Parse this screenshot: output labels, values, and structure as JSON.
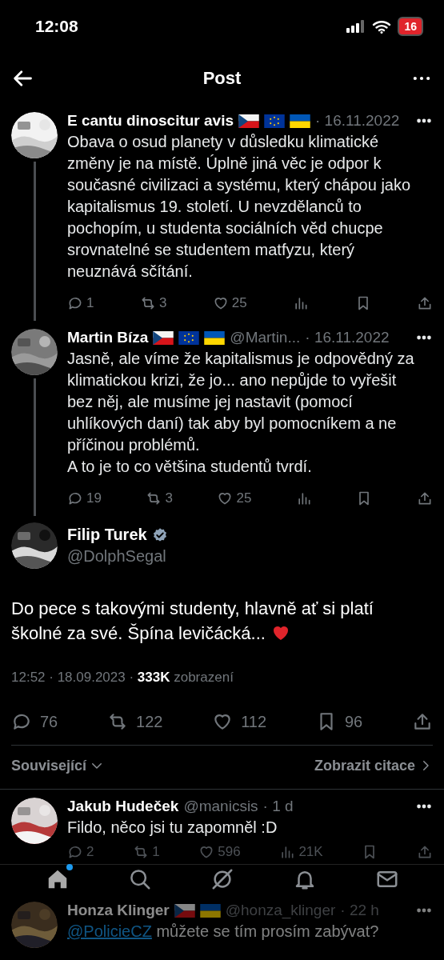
{
  "status_bar": {
    "time": "12:08",
    "battery": "16"
  },
  "header": {
    "title": "Post"
  },
  "thread": [
    {
      "name": "E cantu dinoscitur avis",
      "flags": [
        {
          "kind": "cz"
        },
        {
          "kind": "eu"
        },
        {
          "kind": "ua"
        }
      ],
      "date": "· 16.11.2022",
      "text": "Obava o osud planety v důsledku klimatické změny je na místě. Úplně jiná věc je odpor k současné civilizaci a systému, který chápou jako kapitalismus 19. století. U nevzdělanců to pochopím, u studenta sociálních věd chucpe srovnatelné se studentem matfyzu, který neuznává sčítání.",
      "replies": "1",
      "reposts": "3",
      "likes": "25"
    },
    {
      "name": "Martin Bíza",
      "flags": [
        {
          "kind": "cz"
        },
        {
          "kind": "eu"
        },
        {
          "kind": "ua"
        }
      ],
      "handle": "@Martin...",
      "date": "· 16.11.2022",
      "text": "Jasně, ale víme že kapitalismus je odpovědný za klimatickou krizi, že jo...   ano nepůjde to vyřešit bez něj, ale musíme jej nastavit (pomocí uhlíkových daní) tak aby byl pomocníkem a ne příčinou problémů.\nA to je to co většina studentů tvrdí.",
      "replies": "19",
      "reposts": "3",
      "likes": "25"
    }
  ],
  "post": {
    "name": "Filip Turek",
    "verified": true,
    "handle": "@DolphSegal",
    "text": "Do pece s takovými studenty, hlavně ať si platí školné za své. Špína levičácká...",
    "meta": "12:52 · 18.09.2023 · **333K** zobrazení",
    "replies": "76",
    "reposts": "122",
    "likes": "112",
    "bookmarks": "96"
  },
  "links": {
    "related": "Související",
    "quotes": "Zobrazit citace"
  },
  "replies": [
    {
      "name": "Jakub Hudeček",
      "handle": "@manicsis",
      "date": "· 1 d",
      "text": "Fildo, něco jsi tu zapomněl :D",
      "replies": "2",
      "reposts": "1",
      "likes": "596",
      "views": "21K"
    },
    {
      "name": "Honza Klinger",
      "flags": [
        {
          "kind": "cz"
        },
        {
          "kind": "ua"
        }
      ],
      "handle": "@honza_klinger",
      "date": "· 22 h",
      "mention": "@PolicieCZ",
      "text": "můžete se tím prosím zabývat?"
    }
  ],
  "tabs": [
    {
      "kind": "home",
      "selected": true,
      "badge": true
    },
    {
      "kind": "search",
      "selected": false,
      "badge": false
    },
    {
      "kind": "grok",
      "selected": false,
      "badge": false
    },
    {
      "kind": "notifications",
      "selected": false,
      "badge": false
    },
    {
      "kind": "messages",
      "selected": false,
      "badge": false
    }
  ]
}
